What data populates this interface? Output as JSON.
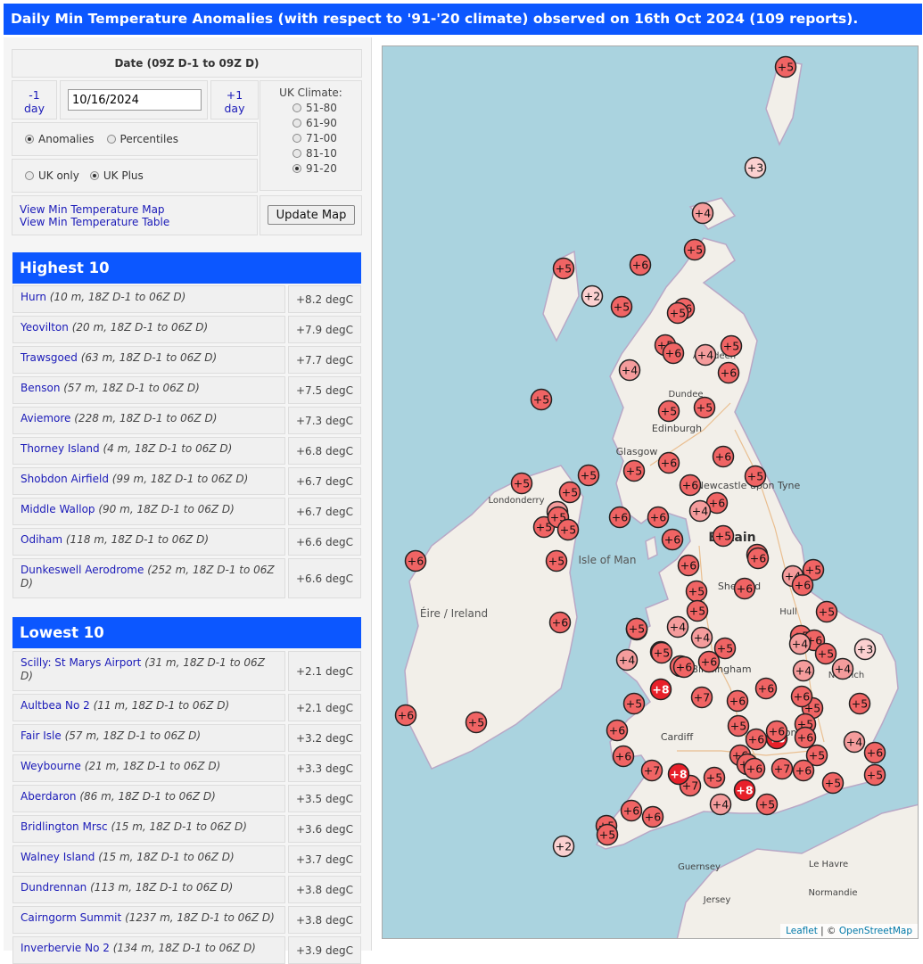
{
  "header": {
    "title": "Daily Min Temperature Anomalies (with respect to '91-'20 climate) observed on 16th Oct 2024 (109 reports)."
  },
  "controls": {
    "date_title": "Date (09Z D-1 to 09Z D)",
    "prev_label": "-1 day",
    "next_label": "+1 day",
    "date_value": "10/16/2024",
    "climate_title": "UK Climate:",
    "climate_options": [
      "51-80",
      "61-90",
      "71-00",
      "81-10",
      "91-20"
    ],
    "climate_selected": "91-20",
    "mode_options": [
      "Anomalies",
      "Percentiles"
    ],
    "mode_selected": "Anomalies",
    "region_options": [
      "UK only",
      "UK Plus"
    ],
    "region_selected": "UK Plus",
    "link_map": "View Min Temperature Map",
    "link_table": "View Min Temperature Table",
    "update_button": "Update Map"
  },
  "highest": {
    "title": "Highest 10",
    "rows": [
      {
        "station": "Hurn",
        "meta": "(10 m, 18Z D-1 to 06Z D)",
        "value": "+8.2 degC"
      },
      {
        "station": "Yeovilton",
        "meta": "(20 m, 18Z D-1 to 06Z D)",
        "value": "+7.9 degC"
      },
      {
        "station": "Trawsgoed",
        "meta": "(63 m, 18Z D-1 to 06Z D)",
        "value": "+7.7 degC"
      },
      {
        "station": "Benson",
        "meta": "(57 m, 18Z D-1 to 06Z D)",
        "value": "+7.5 degC"
      },
      {
        "station": "Aviemore",
        "meta": "(228 m, 18Z D-1 to 06Z D)",
        "value": "+7.3 degC"
      },
      {
        "station": "Thorney Island",
        "meta": "(4 m, 18Z D-1 to 06Z D)",
        "value": "+6.8 degC"
      },
      {
        "station": "Shobdon Airfield",
        "meta": "(99 m, 18Z D-1 to 06Z D)",
        "value": "+6.7 degC"
      },
      {
        "station": "Middle Wallop",
        "meta": "(90 m, 18Z D-1 to 06Z D)",
        "value": "+6.7 degC"
      },
      {
        "station": "Odiham",
        "meta": "(118 m, 18Z D-1 to 06Z D)",
        "value": "+6.6 degC"
      },
      {
        "station": "Dunkeswell Aerodrome",
        "meta": "(252 m, 18Z D-1 to 06Z D)",
        "value": "+6.6 degC"
      }
    ]
  },
  "lowest": {
    "title": "Lowest 10",
    "rows": [
      {
        "station": "Scilly: St Marys Airport",
        "meta": "(31 m, 18Z D-1 to 06Z D)",
        "value": "+2.1 degC"
      },
      {
        "station": "Aultbea No 2",
        "meta": "(11 m, 18Z D-1 to 06Z D)",
        "value": "+2.1 degC"
      },
      {
        "station": "Fair Isle",
        "meta": "(57 m, 18Z D-1 to 06Z D)",
        "value": "+3.2 degC"
      },
      {
        "station": "Weybourne",
        "meta": "(21 m, 18Z D-1 to 06Z D)",
        "value": "+3.3 degC"
      },
      {
        "station": "Aberdaron",
        "meta": "(86 m, 18Z D-1 to 06Z D)",
        "value": "+3.5 degC"
      },
      {
        "station": "Bridlington Mrsc",
        "meta": "(15 m, 18Z D-1 to 06Z D)",
        "value": "+3.6 degC"
      },
      {
        "station": "Walney Island",
        "meta": "(15 m, 18Z D-1 to 06Z D)",
        "value": "+3.7 degC"
      },
      {
        "station": "Dundrennan",
        "meta": "(113 m, 18Z D-1 to 06Z D)",
        "value": "+3.8 degC"
      },
      {
        "station": "Cairngorm Summit",
        "meta": "(1237 m, 18Z D-1 to 06Z D)",
        "value": "+3.8 degC"
      },
      {
        "station": "Inverbervie No 2",
        "meta": "(134 m, 18Z D-1 to 06Z D)",
        "value": "+3.9 degC"
      }
    ]
  },
  "map": {
    "place_labels": [
      "Britain",
      "Éire / Ireland",
      "Isle of Man",
      "Edinburgh",
      "Glasgow",
      "Aberdeen",
      "Dundee",
      "Newcastle upon Tyne",
      "Sheffield",
      "Birmingham",
      "Cardiff",
      "London",
      "Norwich",
      "Hull",
      "Londonderry",
      "Le Havre",
      "Normandie",
      "Jersey",
      "Guernsey"
    ],
    "attribution_leaflet": "Leaflet",
    "attribution_sep": " | © ",
    "attribution_osm": "OpenStreetMap",
    "marker_colors": {
      "warm": "#f06464",
      "mid": "#f59c9c",
      "cool": "#fbd0d0",
      "hot": "#e8202a"
    },
    "markers": [
      "+5",
      "+3",
      "+4",
      "+5",
      "+5",
      "+6",
      "+2",
      "+5",
      "+6",
      "+5",
      "+5",
      "+6",
      "+4",
      "+5",
      "+6",
      "+4",
      "+5",
      "+5",
      "+5",
      "+5",
      "+5",
      "+5",
      "+6",
      "+6",
      "+5",
      "+4",
      "+5",
      "+5",
      "+5",
      "+5",
      "+6",
      "+6",
      "+6",
      "+5",
      "+6",
      "+4",
      "+6",
      "+6",
      "+5",
      "+6",
      "+5",
      "+5",
      "+6",
      "+4",
      "+4",
      "+4",
      "+5",
      "+4",
      "+5",
      "+5",
      "+6",
      "+6",
      "+6",
      "+5",
      "+5",
      "+5",
      "+5",
      "+6",
      "+4",
      "+5",
      "+4",
      "+4",
      "+3",
      "+5",
      "+5",
      "+6",
      "+4",
      "+5",
      "+5",
      "+6",
      "+5",
      "+8",
      "+7",
      "+6",
      "+6",
      "+6",
      "+5",
      "+5",
      "+6",
      "+5",
      "+6",
      "+6",
      "+6",
      "+5",
      "+6",
      "+8",
      "+6",
      "+6",
      "+5",
      "+4",
      "+5",
      "+6",
      "+6",
      "+7",
      "+7",
      "+8",
      "+7",
      "+6",
      "+7",
      "+8",
      "+5",
      "+6",
      "+6",
      "+4",
      "+5",
      "+5",
      "+2",
      "+5",
      "+5"
    ]
  }
}
